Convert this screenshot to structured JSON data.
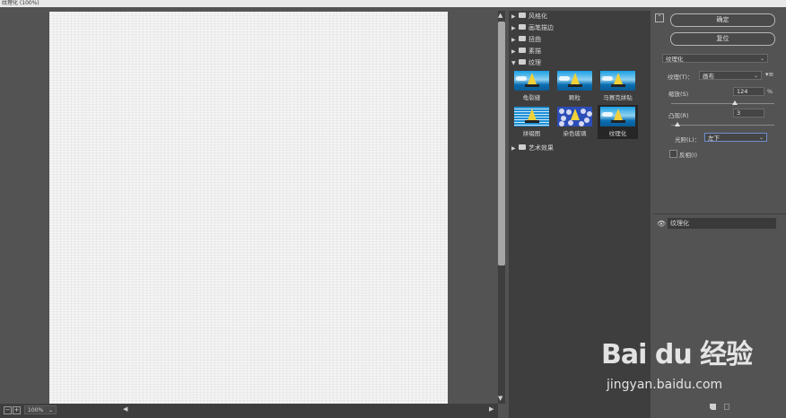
{
  "window": {
    "title": "纹理化 (100%)"
  },
  "preview": {
    "zoom": "100%",
    "zoom_out_label": "−",
    "zoom_in_label": "+"
  },
  "gallery": {
    "categories_top": [
      {
        "label": "风格化"
      },
      {
        "label": "画笔描边"
      },
      {
        "label": "扭曲"
      },
      {
        "label": "素描"
      },
      {
        "label": "纹理"
      }
    ],
    "thumbnails": [
      {
        "label": "龟裂缝"
      },
      {
        "label": "颗粒"
      },
      {
        "label": "马赛克拼贴"
      },
      {
        "label": "拼缀图"
      },
      {
        "label": "染色玻璃"
      },
      {
        "label": "纹理化"
      }
    ],
    "categories_bottom": [
      {
        "label": "艺术效果"
      }
    ],
    "selected_thumbnail": "纹理化"
  },
  "settings": {
    "ok_label": "确定",
    "reset_label": "复位",
    "filter_select": "纹理化",
    "texture_label": "纹理(T)：",
    "texture_value": "画布",
    "scaling_label": "缩放(S)",
    "scaling_value": "124",
    "scaling_unit": "%",
    "scaling_fraction": 0.62,
    "relief_label": "凸现(R)",
    "relief_value": "3",
    "relief_fraction": 0.06,
    "light_label": "光照(L)：",
    "light_value": "左下",
    "invert_label": "反相(I)",
    "invert_checked": false
  },
  "layers": {
    "items": [
      {
        "label": "纹理化"
      }
    ]
  },
  "watermark": {
    "brand": "Bai du 经验",
    "url": "jingyan.baidu.com"
  }
}
